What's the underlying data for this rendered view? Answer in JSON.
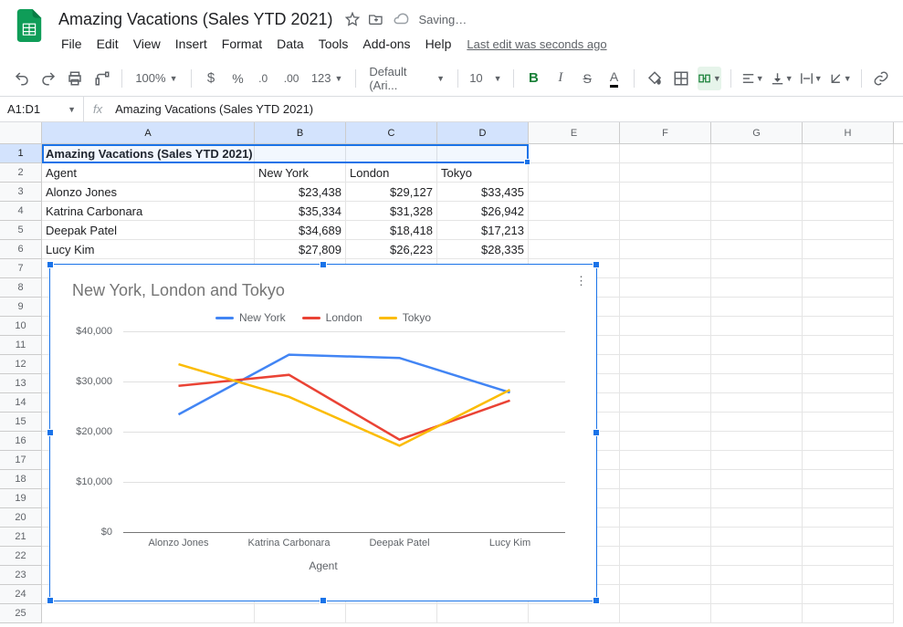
{
  "doc": {
    "title": "Amazing Vacations (Sales YTD 2021)",
    "saving": "Saving…"
  },
  "menu": [
    "File",
    "Edit",
    "View",
    "Insert",
    "Format",
    "Data",
    "Tools",
    "Add-ons",
    "Help"
  ],
  "last_edit": "Last edit was seconds ago",
  "toolbar": {
    "zoom": "100%",
    "more_formats": "123",
    "font": "Default (Ari...",
    "font_size": "10"
  },
  "namebox": "A1:D1",
  "formula_bar": "Amazing Vacations (Sales YTD 2021)",
  "columns": [
    "A",
    "B",
    "C",
    "D",
    "E",
    "F",
    "G",
    "H"
  ],
  "sheet": {
    "title": "Amazing Vacations (Sales YTD 2021)",
    "headers": [
      "Agent",
      "New York",
      "London",
      "Tokyo"
    ],
    "rows": [
      {
        "agent": "Alonzo Jones",
        "ny": "$23,438",
        "ldn": "$29,127",
        "tky": "$33,435"
      },
      {
        "agent": "Katrina Carbonara",
        "ny": "$35,334",
        "ldn": "$31,328",
        "tky": "$26,942"
      },
      {
        "agent": "Deepak Patel",
        "ny": "$34,689",
        "ldn": "$18,418",
        "tky": "$17,213"
      },
      {
        "agent": "Lucy Kim",
        "ny": "$27,809",
        "ldn": "$26,223",
        "tky": "$28,335"
      }
    ]
  },
  "chart_data": {
    "type": "line",
    "title": "New York, London and Tokyo",
    "xlabel": "Agent",
    "ylabel": "",
    "categories": [
      "Alonzo Jones",
      "Katrina Carbonara",
      "Deepak Patel",
      "Lucy Kim"
    ],
    "series": [
      {
        "name": "New York",
        "color": "#4285f4",
        "values": [
          23438,
          35334,
          34689,
          27809
        ]
      },
      {
        "name": "London",
        "color": "#ea4335",
        "values": [
          29127,
          31328,
          18418,
          26223
        ]
      },
      {
        "name": "Tokyo",
        "color": "#fbbc04",
        "values": [
          33435,
          26942,
          17213,
          28335
        ]
      }
    ],
    "ylim": [
      0,
      40000
    ],
    "yticks": [
      "$0",
      "$10,000",
      "$20,000",
      "$30,000",
      "$40,000"
    ]
  }
}
